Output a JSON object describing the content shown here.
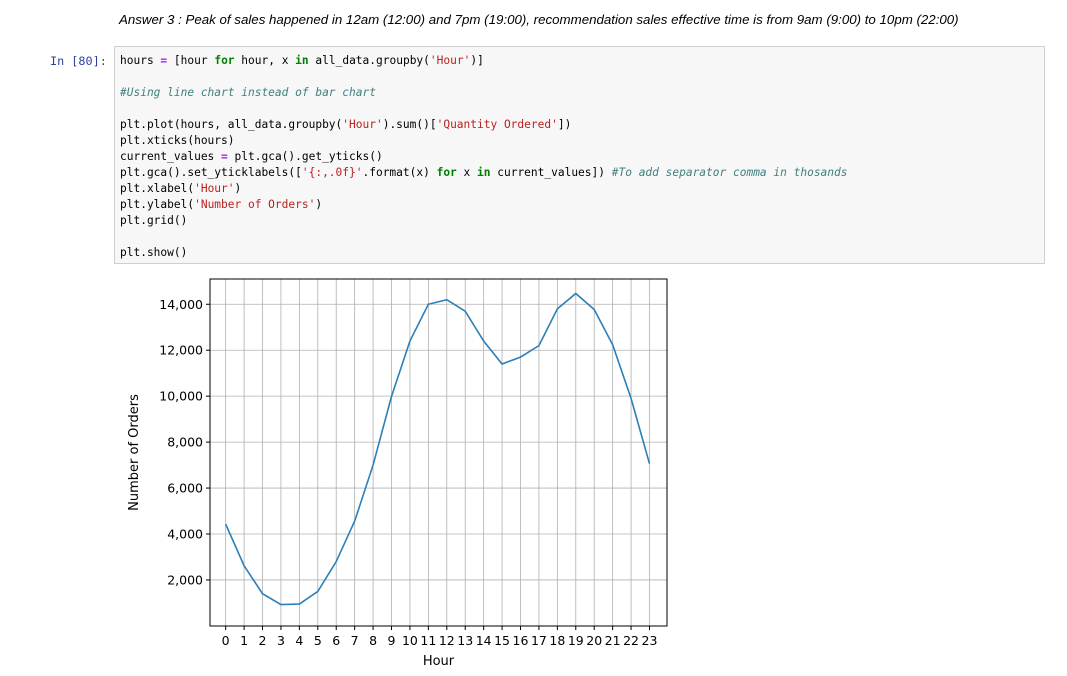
{
  "markdown": {
    "answer_text": "Answer 3 : Peak of sales happened in 12am (12:00) and 7pm (19:00), recommendation sales effective time is from 9am (9:00) to 10pm (22:00)"
  },
  "cell": {
    "prompt": "In [80]:",
    "code_lines": [
      [
        {
          "t": "hours "
        },
        {
          "t": "=",
          "c": "op"
        },
        {
          "t": " [hour "
        },
        {
          "t": "for",
          "c": "kw"
        },
        {
          "t": " hour, x "
        },
        {
          "t": "in",
          "c": "kw"
        },
        {
          "t": " all_data.groupby("
        },
        {
          "t": "'Hour'",
          "c": "str"
        },
        {
          "t": ")]"
        }
      ],
      [],
      [
        {
          "t": "#Using line chart instead of bar chart",
          "c": "cm"
        }
      ],
      [],
      [
        {
          "t": "plt.plot(hours, all_data.groupby("
        },
        {
          "t": "'Hour'",
          "c": "str"
        },
        {
          "t": ").sum()["
        },
        {
          "t": "'Quantity Ordered'",
          "c": "str"
        },
        {
          "t": "])"
        }
      ],
      [
        {
          "t": "plt.xticks(hours)"
        }
      ],
      [
        {
          "t": "current_values "
        },
        {
          "t": "=",
          "c": "op"
        },
        {
          "t": " plt.gca().get_yticks()"
        }
      ],
      [
        {
          "t": "plt.gca().set_yticklabels(["
        },
        {
          "t": "'{:,.0f}'",
          "c": "str"
        },
        {
          "t": ".format(x) "
        },
        {
          "t": "for",
          "c": "kw"
        },
        {
          "t": " x "
        },
        {
          "t": "in",
          "c": "kw"
        },
        {
          "t": " current_values]) "
        },
        {
          "t": "#To add separator comma in thosands",
          "c": "cm"
        }
      ],
      [
        {
          "t": "plt.xlabel("
        },
        {
          "t": "'Hour'",
          "c": "str"
        },
        {
          "t": ")"
        }
      ],
      [
        {
          "t": "plt.ylabel("
        },
        {
          "t": "'Number of Orders'",
          "c": "str"
        },
        {
          "t": ")"
        }
      ],
      [
        {
          "t": "plt.grid()"
        }
      ],
      [],
      [
        {
          "t": "plt.show()"
        }
      ]
    ]
  },
  "colors": {
    "line": "#2c7fb8",
    "grid": "#b0b0b0",
    "prompt": "#303f9f"
  },
  "chart_data": {
    "type": "line",
    "xlabel": "Hour",
    "ylabel": "Number of Orders",
    "grid": true,
    "x": [
      0,
      1,
      2,
      3,
      4,
      5,
      6,
      7,
      8,
      9,
      10,
      11,
      12,
      13,
      14,
      15,
      16,
      17,
      18,
      19,
      20,
      21,
      22,
      23
    ],
    "xticklabels": [
      "0",
      "1",
      "2",
      "3",
      "4",
      "5",
      "6",
      "7",
      "8",
      "9",
      "10",
      "11",
      "12",
      "13",
      "14",
      "15",
      "16",
      "17",
      "18",
      "19",
      "20",
      "21",
      "22",
      "23"
    ],
    "series": [
      {
        "values": [
          4430,
          2620,
          1400,
          930,
          950,
          1500,
          2800,
          4560,
          7000,
          9990,
          12400,
          14000,
          14200,
          13700,
          12400,
          11400,
          11700,
          12200,
          13800,
          14470,
          13770,
          12240,
          9900,
          7060
        ]
      }
    ],
    "yticks": [
      2000,
      4000,
      6000,
      8000,
      10000,
      12000,
      14000
    ],
    "yticklabels": [
      "2,000",
      "4,000",
      "6,000",
      "8,000",
      "10,000",
      "12,000",
      "14,000"
    ],
    "xlim": [
      -0.85,
      23.95
    ],
    "ylim": [
      -5,
      15100
    ]
  }
}
